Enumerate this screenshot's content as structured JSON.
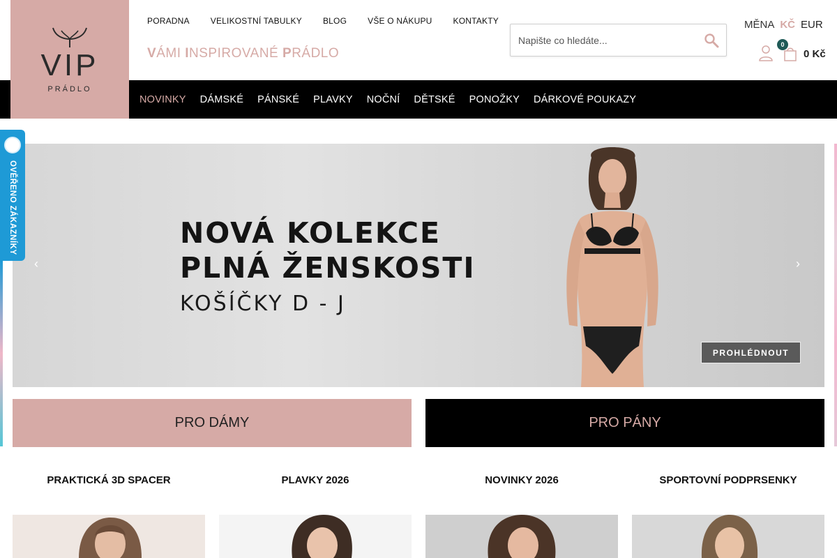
{
  "logo": {
    "name": "VIP",
    "sub": "PRÁDLO"
  },
  "topnav": [
    {
      "label": "PORADNA"
    },
    {
      "label": "VELIKOSTNÍ TABULKY"
    },
    {
      "label": "BLOG"
    },
    {
      "label": "VŠE O NÁKUPU"
    },
    {
      "label": "KONTAKTY"
    }
  ],
  "tagline": {
    "w1_first": "V",
    "w1_rest": "ÁMI ",
    "w2_first": "I",
    "w2_rest": "NSPIROVANÉ ",
    "w3_first": "P",
    "w3_rest": "RÁDLO"
  },
  "search": {
    "placeholder": "Napište co hledáte..."
  },
  "currency": {
    "label": "MĚNA",
    "kc": "KČ",
    "eur": "EUR"
  },
  "cart": {
    "count": "0",
    "total": "0 Kč"
  },
  "mainnav": [
    {
      "label": "NOVINKY"
    },
    {
      "label": "DÁMSKÉ"
    },
    {
      "label": "PÁNSKÉ"
    },
    {
      "label": "PLAVKY"
    },
    {
      "label": "NOČNÍ"
    },
    {
      "label": "DĚTSKÉ"
    },
    {
      "label": "PONOŽKY"
    },
    {
      "label": "DÁRKOVÉ POUKAZY"
    }
  ],
  "verified": {
    "text": "OVĚŘENO ZÁKAZNÍKY"
  },
  "hero": {
    "line1": "NOVÁ KOLEKCE",
    "line2": "PLNÁ ŽENSKOSTI",
    "line3": "KOŠÍČKY D - J",
    "button": "PROHLÉDNOUT",
    "prev": "‹",
    "next": "›"
  },
  "pro": {
    "damy": "PRO DÁMY",
    "pany": "PRO PÁNY"
  },
  "categories": [
    {
      "title": "PRAKTICKÁ 3D SPACER"
    },
    {
      "title": "PLAVKY 2026"
    },
    {
      "title": "NOVINKY 2026"
    },
    {
      "title": "SPORTOVNÍ PODPRSENKY"
    }
  ],
  "colors": {
    "brand_pink": "#d6aaa6",
    "nav_black": "#000000",
    "verified_blue": "#1e9ad6",
    "badge_green": "#1f5a57"
  }
}
